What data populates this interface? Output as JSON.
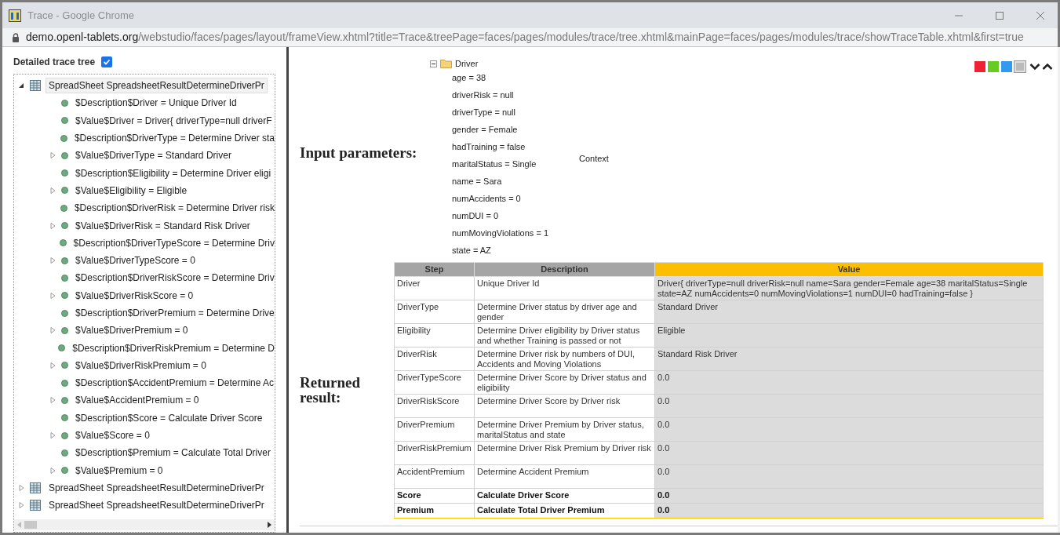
{
  "window": {
    "title": "Trace - Google Chrome"
  },
  "address_bar": {
    "domain": "demo.openl-tablets.org",
    "path": "/webstudio/faces/pages/layout/frameView.xhtml?title=Trace&treePage=faces/pages/modules/trace/tree.xhtml&mainPage=faces/pages/modules/trace/showTraceTable.xhtml&first=true"
  },
  "sidebar": {
    "title": "Detailed trace tree",
    "detailed_checked": true,
    "tree": [
      {
        "label": "SpreadSheet SpreadsheetResultDetermineDriverPr",
        "expanded": true,
        "selected": true,
        "children": [
          {
            "label": "$Description$Driver = Unique Driver Id",
            "expandable": false
          },
          {
            "label": "$Value$Driver = Driver{ driverType=null driverF",
            "expandable": false
          },
          {
            "label": "$Description$DriverType = Determine Driver sta",
            "expandable": false
          },
          {
            "label": "$Value$DriverType = Standard Driver",
            "expandable": true
          },
          {
            "label": "$Description$Eligibility = Determine Driver eligi",
            "expandable": false
          },
          {
            "label": "$Value$Eligibility = Eligible",
            "expandable": true
          },
          {
            "label": "$Description$DriverRisk = Determine Driver risk",
            "expandable": false
          },
          {
            "label": "$Value$DriverRisk = Standard Risk Driver",
            "expandable": true
          },
          {
            "label": "$Description$DriverTypeScore = Determine Driv",
            "expandable": false
          },
          {
            "label": "$Value$DriverTypeScore = 0",
            "expandable": true
          },
          {
            "label": "$Description$DriverRiskScore = Determine Driv",
            "expandable": false
          },
          {
            "label": "$Value$DriverRiskScore = 0",
            "expandable": true
          },
          {
            "label": "$Description$DriverPremium = Determine Drive",
            "expandable": false
          },
          {
            "label": "$Value$DriverPremium = 0",
            "expandable": true
          },
          {
            "label": "$Description$DriverRiskPremium = Determine D",
            "expandable": false
          },
          {
            "label": "$Value$DriverRiskPremium = 0",
            "expandable": true
          },
          {
            "label": "$Description$AccidentPremium = Determine Ac",
            "expandable": false
          },
          {
            "label": "$Value$AccidentPremium = 0",
            "expandable": true
          },
          {
            "label": "$Description$Score = Calculate Driver Score",
            "expandable": false
          },
          {
            "label": "$Value$Score = 0",
            "expandable": true
          },
          {
            "label": "$Description$Premium = Calculate Total Driver",
            "expandable": false
          },
          {
            "label": "$Value$Premium = 0",
            "expandable": true
          }
        ]
      },
      {
        "label": "SpreadSheet SpreadsheetResultDetermineDriverPr",
        "expanded": false,
        "selected": false
      },
      {
        "label": "SpreadSheet SpreadsheetResultDetermineDriverPr",
        "expanded": false,
        "selected": false
      }
    ]
  },
  "color_swatches": [
    {
      "color": "#ee2233",
      "selected": false
    },
    {
      "color": "#66cc22",
      "selected": false
    },
    {
      "color": "#3399ee",
      "selected": false
    },
    {
      "color": "#bbbbbb",
      "selected": true
    }
  ],
  "input_parameters": {
    "heading": "Input parameters:",
    "object": {
      "label": "Driver",
      "expanded": true,
      "fields": [
        "age = 38",
        "driverRisk = null",
        "driverType = null",
        "gender = Female",
        "hadTraining = false",
        "maritalStatus = Single",
        "name = Sara",
        "numAccidents = 0",
        "numDUI = 0",
        "numMovingViolations = 1",
        "state = AZ"
      ]
    },
    "context": "Context"
  },
  "returned_result": {
    "heading": "Returned result:",
    "table": {
      "columns": [
        "Step",
        "Description",
        "Value"
      ],
      "rows": [
        {
          "kind": "step",
          "cells": [
            "Driver",
            "Unique Driver Id",
            "Driver{ driverType=null driverRisk=null name=Sara gender=Female age=38 maritalStatus=Single state=AZ numAccidents=0 numMovingViolations=1 numDUI=0 hadTraining=false }"
          ]
        },
        {
          "kind": "step",
          "cells": [
            "DriverType",
            "Determine Driver status by driver age and gender",
            "Standard Driver"
          ]
        },
        {
          "kind": "step",
          "cells": [
            "Eligibility",
            "Determine Driver eligibility by Driver status and whether Training is passed or not",
            "Eligible"
          ]
        },
        {
          "kind": "step",
          "cells": [
            "DriverRisk",
            "Determine Driver risk by numbers of DUI, Accidents and Moving Violations",
            "Standard Risk Driver"
          ]
        },
        {
          "kind": "step",
          "cells": [
            "DriverTypeScore",
            "Determine Driver Score by Driver status and eligibility",
            "0.0"
          ]
        },
        {
          "kind": "step",
          "cells": [
            "DriverRiskScore",
            "Determine Driver Score by Driver risk",
            "0.0"
          ]
        },
        {
          "kind": "step",
          "cells": [
            "DriverPremium",
            "Determine Driver Premium by Driver status, maritalStatus and state",
            "0.0"
          ]
        },
        {
          "kind": "step",
          "cells": [
            "DriverRiskPremium",
            "Determine Driver Risk Premium by Driver risk",
            "0.0"
          ]
        },
        {
          "kind": "step",
          "cells": [
            "AccidentPremium",
            "Determine Accident Premium",
            "0.0"
          ]
        },
        {
          "kind": "result",
          "cells": [
            "Score",
            "Calculate Driver Score",
            "0.0"
          ]
        },
        {
          "kind": "result",
          "cells": [
            "Premium",
            "Calculate Total Driver Premium",
            "0.0"
          ]
        }
      ]
    }
  }
}
